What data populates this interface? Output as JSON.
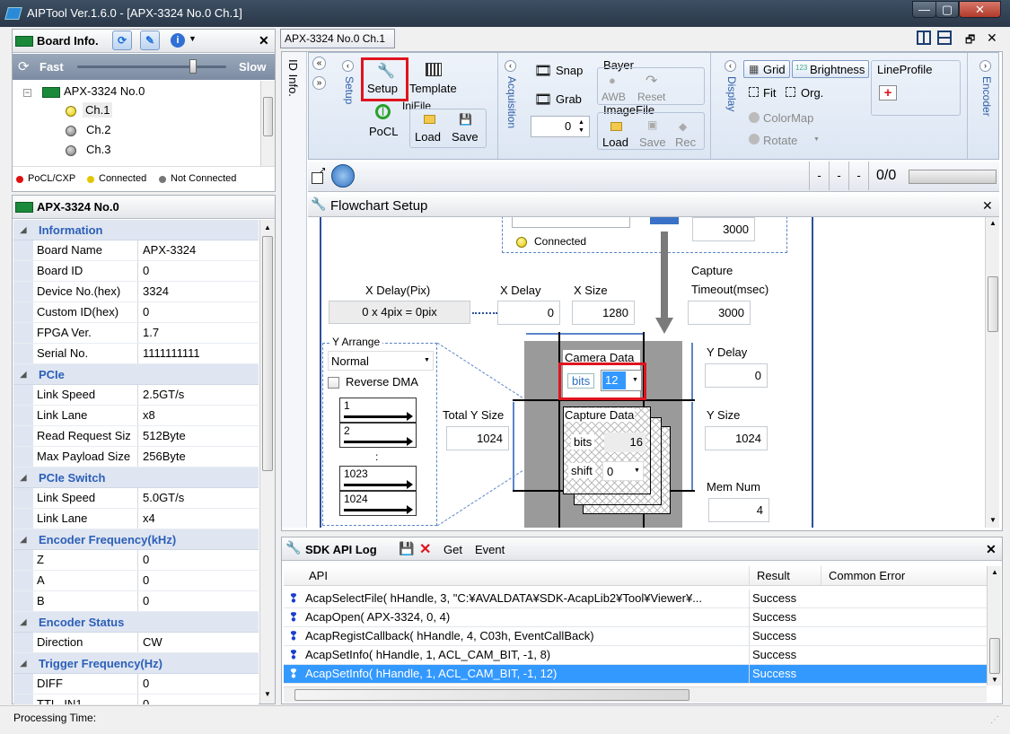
{
  "window": {
    "app_title": "AIPTool Ver.1.6.0 - [APX-3324 No.0 Ch.1]",
    "min": "—",
    "max": "▢",
    "close": "✕"
  },
  "board_info": {
    "title": "Board Info.",
    "speed_fast": "Fast",
    "speed_slow": "Slow",
    "speed_value": 0.78,
    "tree_root": "APX-3324 No.0",
    "channels": [
      "Ch.1",
      "Ch.2",
      "Ch.3"
    ],
    "legend": {
      "pocl": "PoCL/CXP",
      "connected": "Connected",
      "not_connected": "Not Connected"
    }
  },
  "properties": {
    "title": "APX-3324 No.0",
    "rows": [
      {
        "cat": "Information"
      },
      {
        "k": "Board Name",
        "v": "APX-3324"
      },
      {
        "k": "Board ID",
        "v": "0"
      },
      {
        "k": "Device No.(hex)",
        "v": "3324"
      },
      {
        "k": "Custom ID(hex)",
        "v": "0"
      },
      {
        "k": "FPGA Ver.",
        "v": "1.7"
      },
      {
        "k": "Serial No.",
        "v": "1111111111"
      },
      {
        "cat": "PCIe"
      },
      {
        "k": "Link Speed",
        "v": "2.5GT/s"
      },
      {
        "k": "Link Lane",
        "v": "x8"
      },
      {
        "k": "Read Request Siz",
        "v": "512Byte"
      },
      {
        "k": "Max Payload Size",
        "v": "256Byte"
      },
      {
        "cat": "PCIe Switch"
      },
      {
        "k": "Link Speed",
        "v": "5.0GT/s"
      },
      {
        "k": "Link Lane",
        "v": "x4"
      },
      {
        "cat": "Encoder Frequency(kHz)"
      },
      {
        "k": "Z",
        "v": "0"
      },
      {
        "k": "A",
        "v": "0"
      },
      {
        "k": "B",
        "v": "0"
      },
      {
        "cat": "Encoder Status"
      },
      {
        "k": "Direction",
        "v": "CW"
      },
      {
        "cat": "Trigger Frequency(Hz)"
      },
      {
        "k": "DIFF",
        "v": "0"
      },
      {
        "k": "TTL_IN1",
        "v": "0"
      }
    ]
  },
  "doc_tab": "APX-3324 No.0 Ch.1",
  "ribbon": {
    "id_info": "ID Info.",
    "setup_group": "Setup",
    "setup": "Setup",
    "template": "Template",
    "pocl": "PoCL",
    "inifile": "IniFile",
    "ini_load": "Load",
    "ini_save": "Save",
    "acquisition": "Acquisition",
    "snap": "Snap",
    "grab": "Grab",
    "grab_count": "0",
    "bayer": "Bayer",
    "awb": "AWB",
    "reset": "Reset",
    "imagefile": "ImageFile",
    "img_load": "Load",
    "img_save": "Save",
    "img_rec": "Rec",
    "display": "Display",
    "grid": "Grid",
    "brightness": "Brightness",
    "fit": "Fit",
    "org": "Org.",
    "colormap": "ColorMap",
    "rotate": "Rotate",
    "lineprofile": "LineProfile",
    "encoder": "Encoder"
  },
  "imagebar": {
    "d1": "-",
    "d2": "-",
    "d3": "-",
    "counter": "0/0"
  },
  "flowchart": {
    "title": "Flowchart Setup",
    "connected": "Connected",
    "top_value": "3000",
    "xdelay_pix_label": "X Delay(Pix)",
    "xdelay_pix_value": "0 x 4pix = 0pix",
    "xdelay_label": "X Delay",
    "xdelay_value": "0",
    "xsize_label": "X Size",
    "xsize_value": "1280",
    "capture_timeout_label1": "Capture",
    "capture_timeout_label2": "Timeout(msec)",
    "capture_timeout_value": "3000",
    "y_arrange_label": "Y Arrange",
    "y_arrange_value": "Normal",
    "reverse_dma": "Reverse DMA",
    "rows": [
      "1",
      "2",
      ":",
      "1023",
      "1024"
    ],
    "camera_data": "Camera Data",
    "bits": "bits",
    "camera_bits": "12",
    "capture_data": "Capture Data",
    "capture_bits": "16",
    "shift": "shift",
    "shift_value": "0",
    "total_y_label": "Total Y Size",
    "total_y_value": "1024",
    "ydelay_label": "Y Delay",
    "ydelay_value": "0",
    "ysize_label": "Y Size",
    "ysize_value": "1024",
    "memnum_label": "Mem Num",
    "memnum_value": "4"
  },
  "sdk_log": {
    "title": "SDK API Log",
    "get": "Get",
    "event": "Event",
    "headers": {
      "api": "API",
      "result": "Result",
      "error": "Common Error"
    },
    "rows": [
      {
        "api": "AcapSelectFile( hHandle, 3, \"C:¥AVALDATA¥SDK-AcapLib2¥Tool¥Viewer¥...",
        "result": "Success"
      },
      {
        "api": "AcapOpen( APX-3324, 0, 4)",
        "result": "Success"
      },
      {
        "api": "AcapRegistCallback( hHandle, 4, C03h, EventCallBack)",
        "result": "Success"
      },
      {
        "api": "AcapSetInfo( hHandle, 1, ACL_CAM_BIT, -1, 8)",
        "result": "Success"
      },
      {
        "api": "AcapSetInfo( hHandle, 1, ACL_CAM_BIT, -1, 12)",
        "result": "Success"
      }
    ]
  },
  "status": {
    "processing_time": "Processing Time:"
  }
}
